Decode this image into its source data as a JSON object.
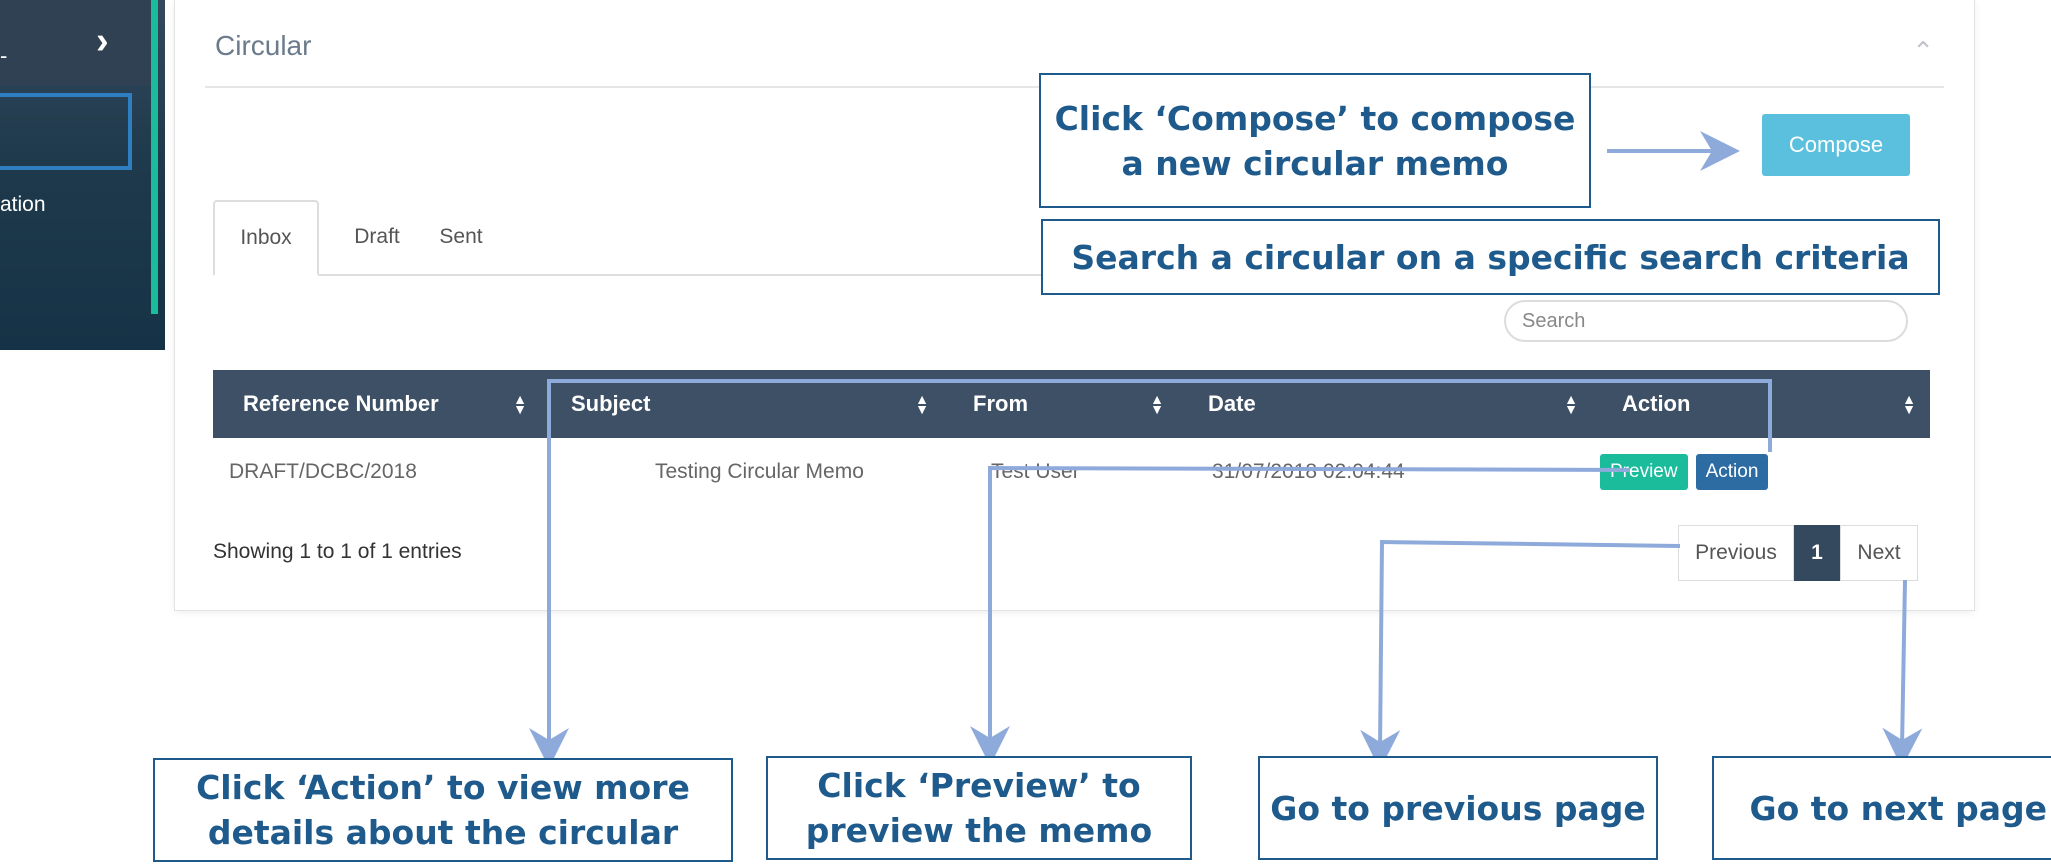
{
  "sidebar": {
    "top_item_fragment": "-",
    "menu_item_fragment": "ation"
  },
  "panel": {
    "title": "Circular",
    "compose_label": "Compose",
    "tabs": [
      {
        "label": "Inbox",
        "active": true
      },
      {
        "label": "Draft",
        "active": false
      },
      {
        "label": "Sent",
        "active": false
      }
    ],
    "search_placeholder": "Search"
  },
  "table": {
    "columns": [
      "Reference Number",
      "Subject",
      "From",
      "Date",
      "Action"
    ],
    "rows": [
      {
        "reference_number": "DRAFT/DCBC/2018",
        "subject": "Testing Circular Memo",
        "from": "Test User",
        "date": "31/07/2018 02:04:44",
        "preview_label": "Preview",
        "action_label": "Action"
      }
    ]
  },
  "footer": {
    "showing_text": "Showing 1 to 1 of 1 entries",
    "pager": {
      "previous": "Previous",
      "current": "1",
      "next": "Next"
    }
  },
  "annotations": {
    "compose": "Click  ‘Compose’ to compose a new circular memo",
    "search": "Search a circular on a specific search criteria",
    "action": "Click  ‘Action’ to view more details about the circular",
    "preview": "Click  ‘Preview’ to preview the memo",
    "previous_page": "Go to previous  page",
    "next_page": "Go to next page"
  },
  "colors": {
    "header_bg": "#3d5066",
    "compose_bg": "#5bc0de",
    "preview_bg": "#1abc9c",
    "action_bg": "#2d6ca3",
    "callout_border": "#1e5a8c",
    "arrow": "#8eaadb"
  },
  "icons": [
    "chevron-right-icon",
    "chevron-up-icon",
    "sort-icon"
  ]
}
